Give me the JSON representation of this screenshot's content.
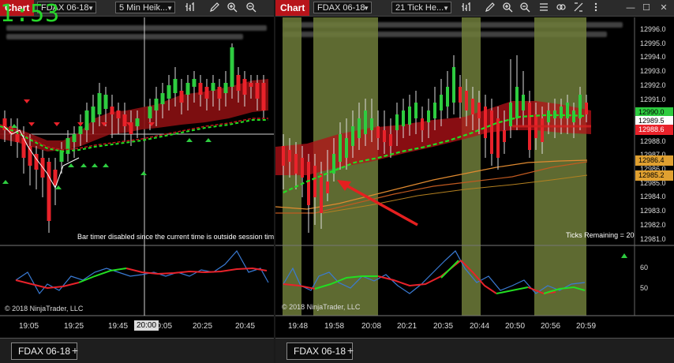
{
  "left_chart": {
    "window_title": "Chart",
    "instrument": "FDAX 06-18",
    "period": "5 Min Heik...",
    "timer": "1:53",
    "message": "Bar timer disabled since the current time is outside session time or",
    "copyright": "© 2018 NinjaTrader, LLC",
    "time_labels": [
      "19:05",
      "19:25",
      "19:45",
      "20:05",
      "20:25",
      "20:45"
    ],
    "crosshair_time": "20:00",
    "tab_label": "FDAX 06-18",
    "add_tab": "+"
  },
  "right_chart": {
    "window_title": "Chart",
    "instrument": "FDAX 06-18",
    "period": "21 Tick He...",
    "price_labels": [
      "12996.0",
      "12995.0",
      "12994.0",
      "12993.0",
      "12992.0",
      "12991.0",
      "12990.0",
      "12989.0",
      "12988.0",
      "12987.0",
      "12986.0",
      "12985.0",
      "12984.0",
      "12983.0",
      "12982.0",
      "12981.0"
    ],
    "price_badges": [
      {
        "value": "12990.0",
        "color": "#2ecc40"
      },
      {
        "value": "12989.5",
        "color": "#ffffff"
      },
      {
        "value": "12988.6",
        "color": "#e8222a"
      },
      {
        "value": "12986.4",
        "color": "#e0a030"
      },
      {
        "value": "12985.2",
        "color": "#e0a030"
      }
    ],
    "ticks_remaining": "Ticks Remaining = 20",
    "indicator_labels": [
      "60",
      "50"
    ],
    "copyright": "© 2018 NinjaTrader, LLC",
    "time_labels": [
      "19:48",
      "19:58",
      "20:08",
      "20:21",
      "20:35",
      "20:44",
      "20:50",
      "20:56",
      "20:59"
    ],
    "tab_label": "FDAX 06-18",
    "add_tab": "+"
  },
  "colors": {
    "chart_red": "#b8141a",
    "bull": "#2ecc40",
    "bear": "#e8222a",
    "session_highlight": "#6f7d3a",
    "arrow": "#e52020"
  }
}
